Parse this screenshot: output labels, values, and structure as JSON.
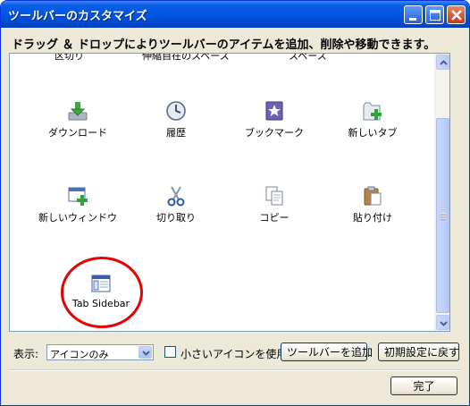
{
  "window": {
    "title": "ツールバーのカスタマイズ",
    "controls": [
      "minimize-icon",
      "maximize-icon",
      "close-icon"
    ]
  },
  "instruction": "ドラッグ ＆ ドロップによりツールバーのアイテムを追加、削除や移動できます。",
  "palette": {
    "partial_labels": [
      "区切り",
      "伸縮自在のスペース",
      "スペース"
    ],
    "items": [
      {
        "label": "ダウンロード",
        "icon": "download-icon"
      },
      {
        "label": "履歴",
        "icon": "history-clock-icon"
      },
      {
        "label": "ブックマーク",
        "icon": "bookmark-star-icon"
      },
      {
        "label": "新しいタブ",
        "icon": "new-tab-icon"
      },
      {
        "label": "新しいウィンドウ",
        "icon": "new-window-icon"
      },
      {
        "label": "切り取り",
        "icon": "scissors-icon"
      },
      {
        "label": "コピー",
        "icon": "copy-icon"
      },
      {
        "label": "貼り付け",
        "icon": "paste-icon"
      },
      {
        "label": "Tab Sidebar",
        "icon": "tab-sidebar-icon"
      }
    ],
    "highlight_color": "#e60000"
  },
  "bottom": {
    "show_label": "表示:",
    "show_value": "アイコンのみ",
    "small_icons_label": "小さいアイコンを使用",
    "small_icons_checked": false,
    "add_toolbar_label": "ツールバーを追加",
    "restore_defaults_label": "初期設定に戻す",
    "done_label": "完了"
  },
  "colors": {
    "titlebar": "#0054e3",
    "dialog_bg": "#ece9d8"
  }
}
